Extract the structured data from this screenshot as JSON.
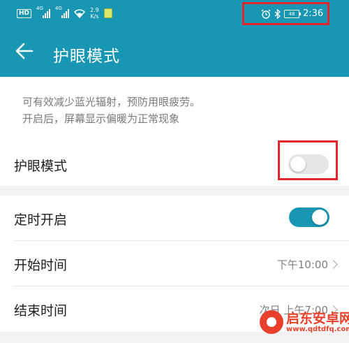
{
  "status_bar": {
    "hd": "HD",
    "net1": "4G",
    "net2": "4G",
    "speed_value": "2.9",
    "speed_unit": "K/s",
    "battery": "48",
    "time": "2:36"
  },
  "toolbar": {
    "title": "护眼模式"
  },
  "description": {
    "line1": "可有效减少蓝光辐射，预防用眼疲劳。",
    "line2": "开启后，屏幕显示偏暖为正常现象"
  },
  "eye_mode": {
    "label": "护眼模式",
    "enabled": false
  },
  "schedule": {
    "label": "定时开启",
    "enabled": true
  },
  "start_time": {
    "label": "开始时间",
    "value": "下午10:00"
  },
  "end_time": {
    "label": "结束时间",
    "value": "次日 上午7:00"
  },
  "watermark": {
    "name": "启东安卓网",
    "url": "www.qdtdfq.com"
  },
  "colors": {
    "accent": "#1996b3",
    "highlight": "#e3262c"
  }
}
